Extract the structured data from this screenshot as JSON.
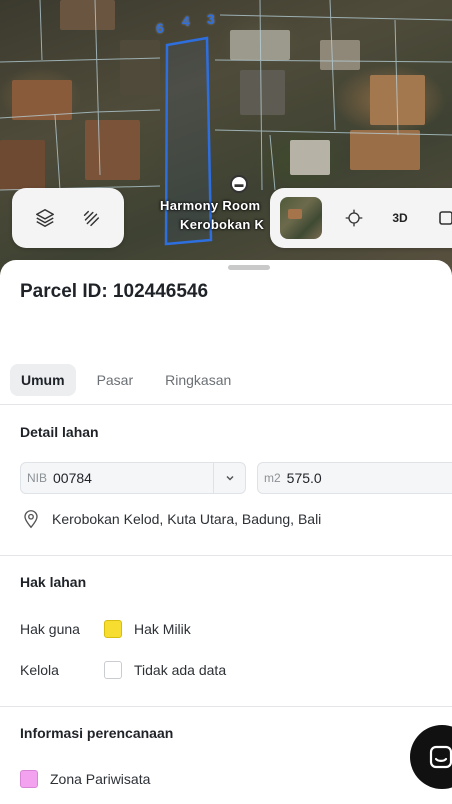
{
  "map": {
    "lot_numbers": [
      "6",
      "4",
      "3"
    ],
    "poi_label_line1": "Harmony Room",
    "poi_label_line2": "Kerobokan K",
    "view_3d_label": "3D",
    "icons": {
      "layers": "layers-icon",
      "measure": "ruler-icon",
      "locate": "crosshair-icon",
      "basemap": "satellite-thumbnail",
      "poi": "hotel-icon"
    }
  },
  "sheet": {
    "parcel_title": "Parcel ID: 102446546",
    "tabs": [
      {
        "label": "Umum",
        "active": true
      },
      {
        "label": "Pasar",
        "active": false
      },
      {
        "label": "Ringkasan",
        "active": false
      }
    ],
    "land_detail": {
      "title": "Detail lahan",
      "nib_prefix": "NIB",
      "nib_value": "00784",
      "area_prefix": "m2",
      "area_value": "575.0",
      "address": "Kerobokan Kelod, Kuta Utara, Badung, Bali"
    },
    "land_rights": {
      "title": "Hak lahan",
      "rows": [
        {
          "key": "Hak guna",
          "value": "Hak Milik",
          "swatch": "#f7dd2f"
        },
        {
          "key": "Kelola",
          "value": "Tidak ada data",
          "swatch": "#ffffff"
        }
      ]
    },
    "planning": {
      "title": "Informasi perencanaan",
      "zone": "Zona Pariwisata",
      "zone_color": "#f2a2ef"
    }
  },
  "colors": {
    "parcel_outline": "#2e6fe0",
    "active_tab_bg": "#eceef0",
    "chat_button": "#111111"
  }
}
